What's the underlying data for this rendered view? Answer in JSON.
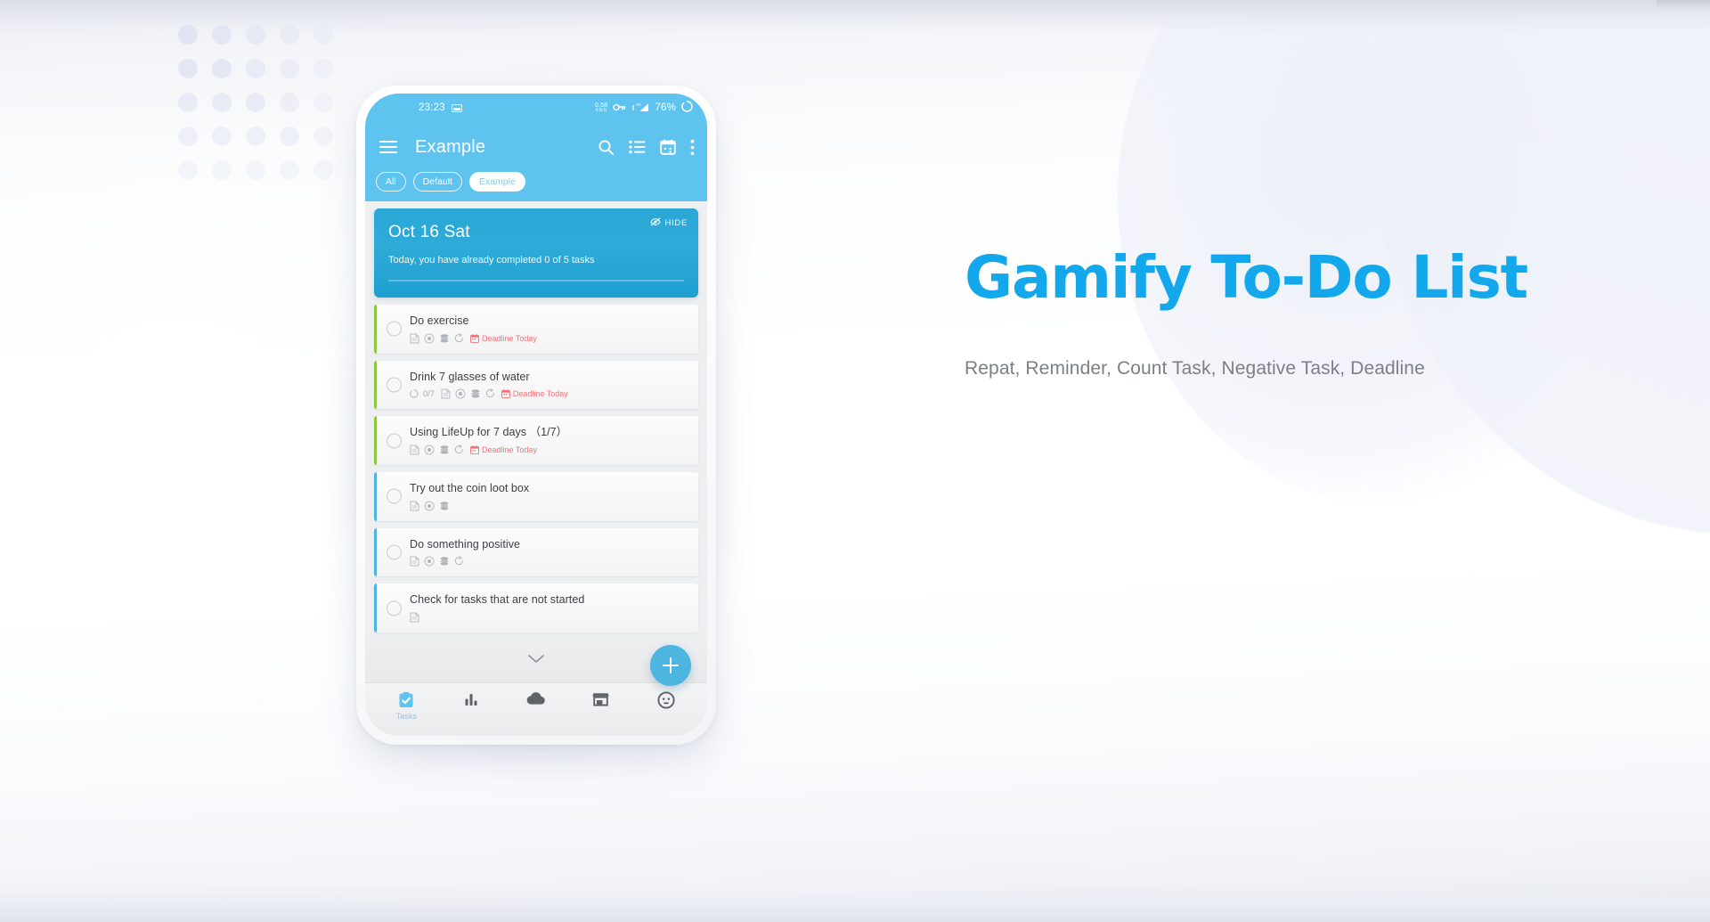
{
  "colors": {
    "brand_blue": "#12a8eb",
    "app_bar_blue": "#5ec3ef",
    "date_card_blue": "#2aa7d6",
    "fab_blue": "#4cb5e0",
    "deadline_red": "#f2737a",
    "accent_green": "#8ec63f",
    "accent_blue": "#4cb5e0",
    "dot_grid": "#dfe3f1",
    "subcopy_gray": "#7b7f86"
  },
  "phone": {
    "status_bar": {
      "time": "23:23",
      "screenshot_icon": "screenshot-icon",
      "net_speed_value": "0.58",
      "net_speed_unit": "KB/S",
      "vpn_icon": "vpn-key-icon",
      "signal_icon": "signal-4g-icon",
      "battery_percent": "76%",
      "battery_icon": "battery-circle-icon"
    },
    "app_bar": {
      "menu_icon": "hamburger-menu-icon",
      "title": "Example",
      "actions": [
        {
          "name": "search-icon",
          "label": "Search"
        },
        {
          "name": "list-view-icon",
          "label": "List view"
        },
        {
          "name": "calendar-icon",
          "label": "Calendar"
        },
        {
          "name": "overflow-menu-icon",
          "label": "More options"
        }
      ]
    },
    "chips": [
      {
        "label": "All",
        "active": false
      },
      {
        "label": "Default",
        "active": false
      },
      {
        "label": "Example",
        "active": true
      }
    ],
    "date_card": {
      "hide_label": "HIDE",
      "hide_icon": "eye-off-icon",
      "date": "Oct 16 Sat",
      "summary": "Today, you have already completed 0 of 5 tasks",
      "progress_percent": 0
    },
    "tasks": [
      {
        "title": "Do exercise",
        "accent": "green",
        "count": null,
        "icons": [
          "note-icon",
          "target-icon",
          "coins-icon",
          "repeat-icon"
        ],
        "deadline": "Deadline Today"
      },
      {
        "title": "Drink 7 glasses of water",
        "accent": "green",
        "count": "0/7",
        "icons": [
          "note-icon",
          "target-icon",
          "coins-icon",
          "repeat-icon"
        ],
        "deadline": "Deadline Today"
      },
      {
        "title": "Using LifeUp for 7 days （1/7）",
        "accent": "green",
        "count": null,
        "icons": [
          "note-icon",
          "target-icon",
          "coins-icon",
          "repeat-icon"
        ],
        "deadline": "Deadline Today"
      },
      {
        "title": "Try out the coin loot box",
        "accent": "blue",
        "count": null,
        "icons": [
          "note-icon",
          "target-icon",
          "coins-icon"
        ],
        "deadline": null
      },
      {
        "title": "Do something positive",
        "accent": "blue",
        "count": null,
        "icons": [
          "note-icon",
          "target-icon",
          "coins-icon",
          "repeat-icon"
        ],
        "deadline": null
      },
      {
        "title": "Check for tasks that are not started",
        "accent": "blue",
        "count": null,
        "icons": [
          "note-icon"
        ],
        "deadline": null
      }
    ],
    "expand_icon": "chevron-down-icon",
    "fab": {
      "icon": "plus-icon",
      "label": "Add task"
    },
    "bottom_nav": [
      {
        "icon": "clipboard-check-icon",
        "label": "Tasks",
        "active": true
      },
      {
        "icon": "bar-chart-icon",
        "label": "",
        "active": false
      },
      {
        "icon": "cloud-icon",
        "label": "",
        "active": false
      },
      {
        "icon": "shop-icon",
        "label": "",
        "active": false
      },
      {
        "icon": "avatar-face-icon",
        "label": "",
        "active": false
      }
    ]
  },
  "marketing": {
    "headline": "Gamify To-Do List",
    "subcopy": "Repat, Reminder, Count Task, Negative Task, Deadline"
  }
}
